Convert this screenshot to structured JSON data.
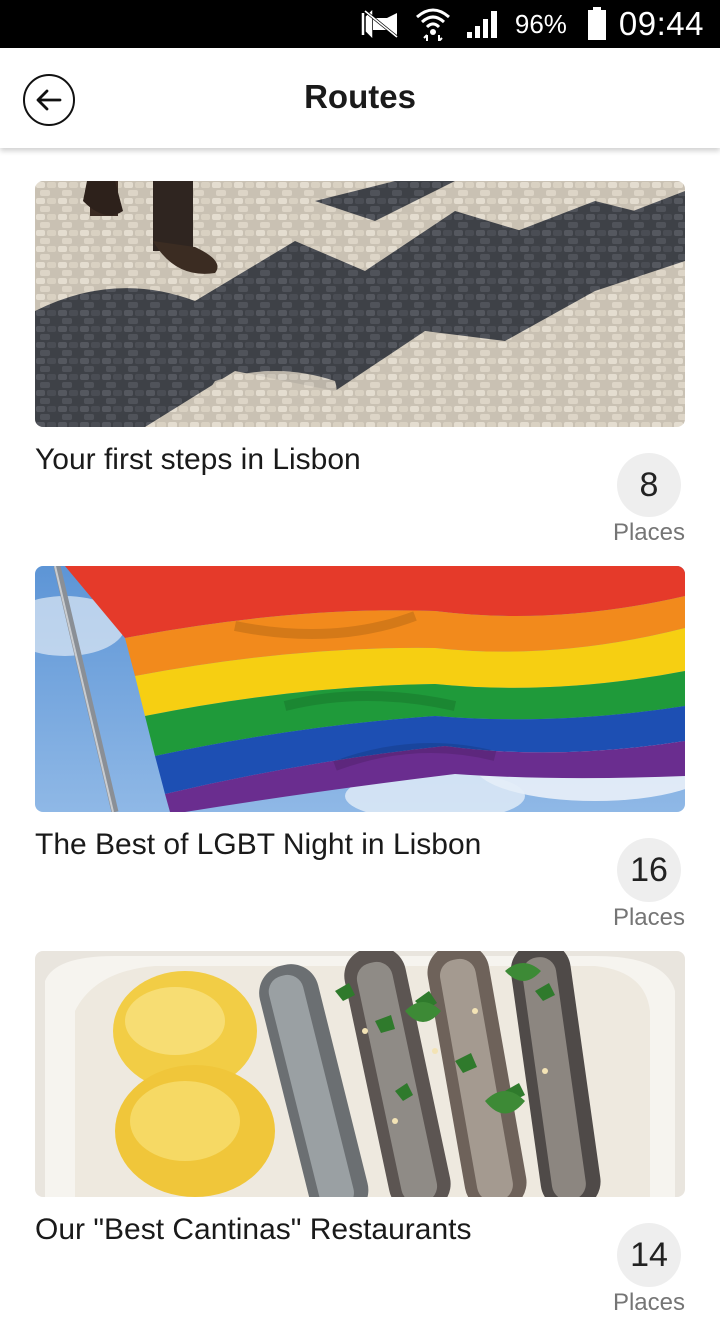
{
  "status_bar": {
    "battery_percent": "96%",
    "time": "09:44",
    "icons": [
      "mute-icon",
      "wifi-icon",
      "signal-icon",
      "battery-icon"
    ]
  },
  "app_bar": {
    "title": "Routes",
    "back_icon": "back-arrow-icon"
  },
  "routes": [
    {
      "name": "Your first steps in Lisbon",
      "count": "8",
      "count_label": "Places",
      "image": "lisbon-cobblestone-pavement"
    },
    {
      "name": "The Best of LGBT Night in Lisbon",
      "count": "16",
      "count_label": "Places",
      "image": "rainbow-flag"
    },
    {
      "name": "Our \"Best Cantinas\" Restaurants",
      "count": "14",
      "count_label": "Places",
      "image": "grilled-sardines-with-potatoes"
    }
  ]
}
